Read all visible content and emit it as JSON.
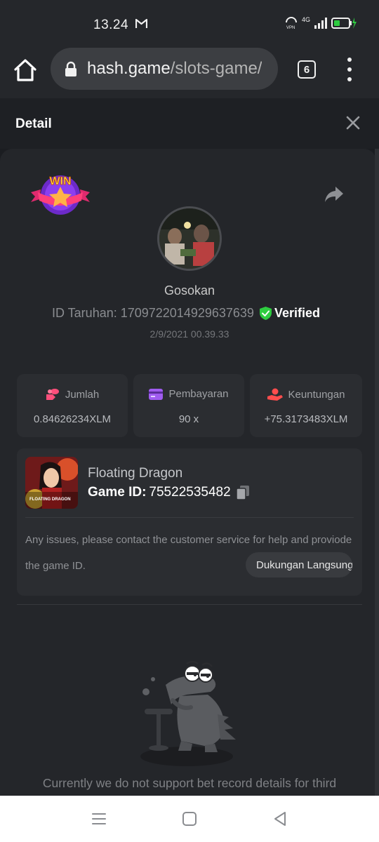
{
  "status_bar": {
    "time": "13.24",
    "network": "4G"
  },
  "browser": {
    "url_host": "hash.game",
    "url_path": "/slots-game/",
    "tab_count": "6"
  },
  "detail": {
    "title": "Detail"
  },
  "bet": {
    "badge": "WIN",
    "username": "Gosokan",
    "bet_id_label": "ID Taruhan: 1709722014929637639",
    "verified_label": "Verified",
    "datetime": "2/9/2021 00.39.33"
  },
  "stats": [
    {
      "label": "Jumlah",
      "value": "0.84626234XLM",
      "icon": "coins-icon",
      "color": "#ff4f7b"
    },
    {
      "label": "Pembayaran",
      "value": "90 x",
      "icon": "card-icon",
      "color": "#a05cf0"
    },
    {
      "label": "Keuntungan",
      "value": "+75.3173483XLM",
      "icon": "profit-hand-icon",
      "color": "#ff4d4d"
    }
  ],
  "game": {
    "name": "Floating Dragon",
    "thumb_title": "FLOATING DRAGON",
    "id_label": "Game ID:",
    "id_value": "75522535482",
    "support_text": "Any issues, please contact the customer service for help and proviode the game ID.",
    "live_support_label": "Dukungan Langsung"
  },
  "footer": {
    "message": "Currently we do not support bet record details for third"
  },
  "colors": {
    "verified_green": "#2ecc40",
    "panel_bg": "#24262a",
    "card_bg": "#2b2d31"
  }
}
